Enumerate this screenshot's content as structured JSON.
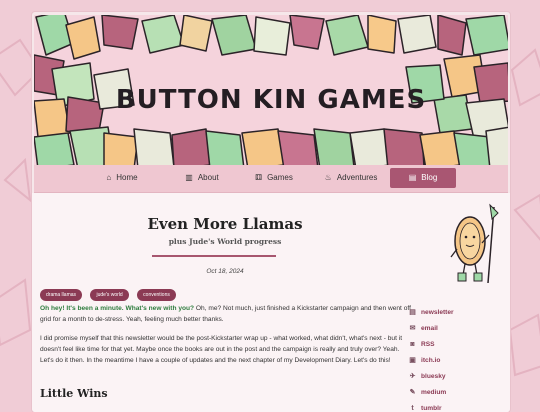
{
  "site": {
    "title": "BUTTON KIN GAMES"
  },
  "nav": [
    {
      "label": "Home",
      "icon": "home-icon",
      "glyph": "⌂",
      "active": false
    },
    {
      "label": "About",
      "icon": "book-icon",
      "glyph": "▥",
      "active": false
    },
    {
      "label": "Games",
      "icon": "dice-icon",
      "glyph": "⚅",
      "active": false
    },
    {
      "label": "Adventures",
      "icon": "flame-icon",
      "glyph": "♨",
      "active": false
    },
    {
      "label": "Blog",
      "icon": "newspaper-icon",
      "glyph": "▤",
      "active": true
    }
  ],
  "post": {
    "title": "Even More Llamas",
    "subtitle": "plus Jude's World progress",
    "date": "Oct 18, 2024",
    "tags": [
      "drama llamas",
      "jude's world",
      "conventions"
    ],
    "p1_highlight": "Oh hey! It's been a minute. What's new with you?",
    "p1_rest": " Oh, me? Not much, just finished a Kickstarter campaign and then went off grid for a month to de-stress. Yeah, feeling much better thanks.",
    "p2": "I did promise myself that this newsletter would be the post-Kickstarter wrap up - what worked, what didn't, what's next - but it doesn't feel like time for that yet. Maybe once the books are out in the post and the campaign is really and truly over? Yeah. Let's do it then. In the meantime I have a couple of updates and the next chapter of my Development Diary. Let's do this!",
    "heading": "Little Wins"
  },
  "sidebar": {
    "links": [
      {
        "label": "newsletter",
        "icon": "newsletter-icon",
        "glyph": "▤"
      },
      {
        "label": "email",
        "icon": "email-icon",
        "glyph": "✉"
      },
      {
        "label": "RSS",
        "icon": "rss-icon",
        "glyph": "◙"
      },
      {
        "label": "itch.io",
        "icon": "itchio-icon",
        "glyph": "▣"
      },
      {
        "label": "bluesky",
        "icon": "bluesky-icon",
        "glyph": "✈"
      },
      {
        "label": "medium",
        "icon": "medium-icon",
        "glyph": "✎"
      },
      {
        "label": "tumblr",
        "icon": "tumblr-icon",
        "glyph": "t"
      }
    ]
  },
  "colors": {
    "accent": "#a95672",
    "tag": "#8b3a54",
    "highlight": "#2e7d3e",
    "background": "#f0ccd6"
  }
}
